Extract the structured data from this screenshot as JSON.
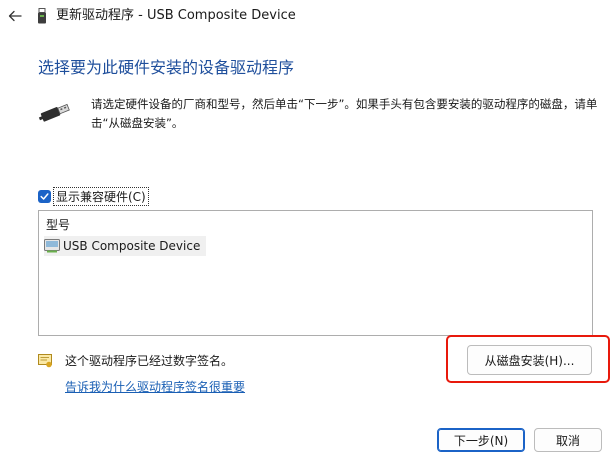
{
  "window": {
    "title": "更新驱动程序 - USB Composite Device",
    "back_icon": "back-arrow-icon",
    "usb_icon": "usb-drive-icon"
  },
  "heading": "选择要为此硬件安装的设备驱动程序",
  "instruction": {
    "icon": "usb-connector-icon",
    "text": "请选定硬件设备的厂商和型号，然后单击“下一步”。如果手头有包含要安装的驱动程序的磁盘，请单击“从磁盘安装”。"
  },
  "compat_checkbox": {
    "label": "显示兼容硬件(C)",
    "checked": true
  },
  "model_list": {
    "header": "型号",
    "items": [
      {
        "label": "USB Composite Device",
        "icon": "device-driver-icon",
        "selected": true
      }
    ]
  },
  "signature": {
    "icon": "signed-driver-icon",
    "text": "这个驱动程序已经过数字签名。",
    "link": "告诉我为什么驱动程序签名很重要"
  },
  "buttons": {
    "have_disk": "从磁盘安装(H)...",
    "next": "下一步(N)",
    "cancel": "取消"
  },
  "colors": {
    "heading": "#1f4f9c",
    "link": "#1a5fb4",
    "accent": "#1b63c7",
    "highlight": "#e8190c"
  }
}
